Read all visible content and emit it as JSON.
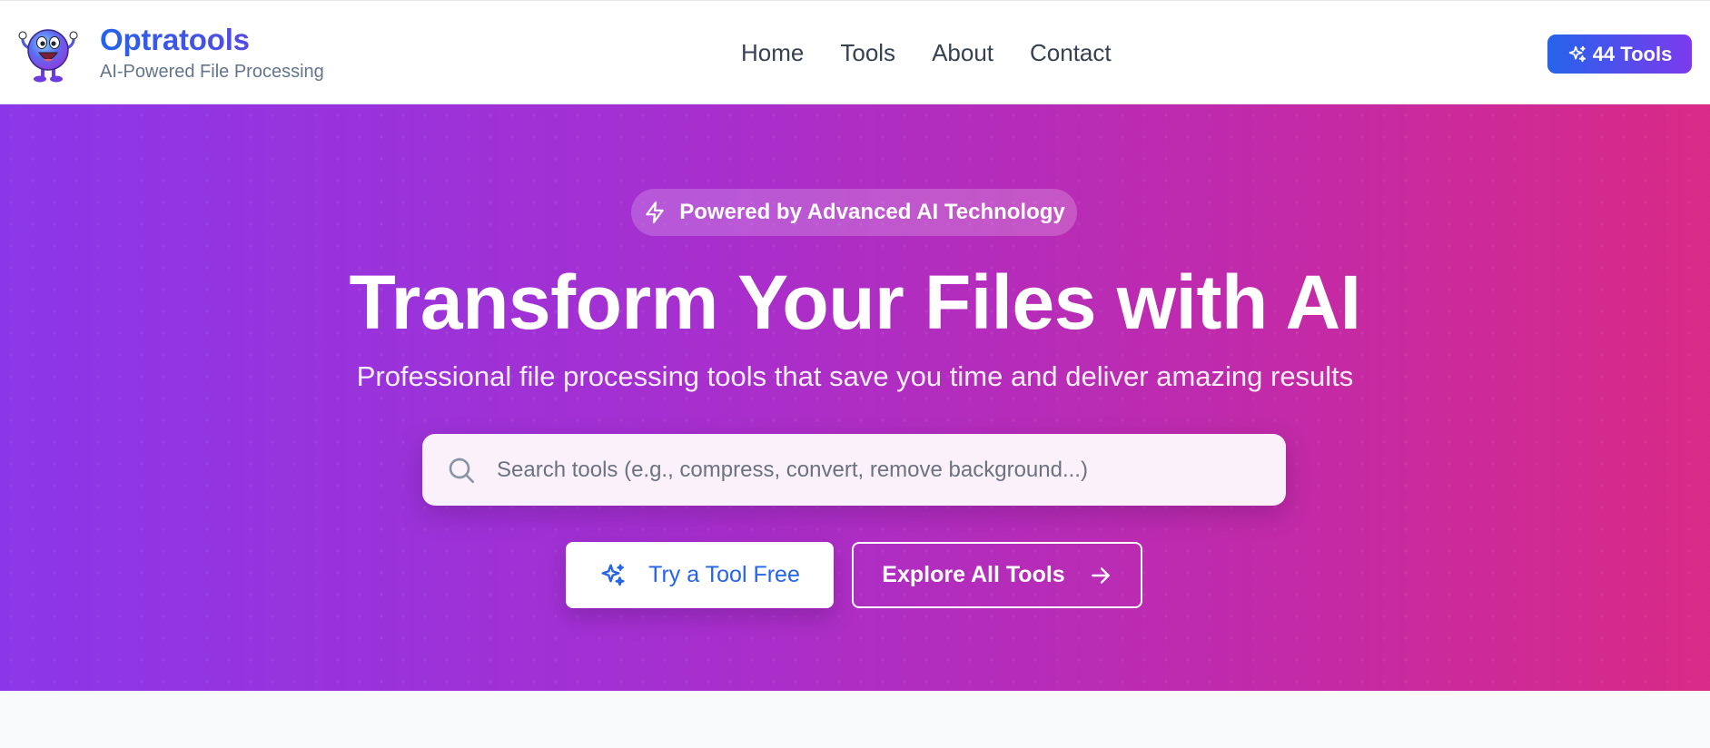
{
  "header": {
    "brand_name": "Optratools",
    "brand_tagline": "AI-Powered File Processing",
    "nav": [
      {
        "label": "Home"
      },
      {
        "label": "Tools"
      },
      {
        "label": "About"
      },
      {
        "label": "Contact"
      }
    ],
    "tools_badge": "44 Tools"
  },
  "hero": {
    "pill_label": "Powered by Advanced AI Technology",
    "title": "Transform Your Files with AI",
    "subtitle": "Professional file processing tools that save you time and deliver amazing results",
    "search": {
      "placeholder": "Search tools (e.g., compress, convert, remove background...)",
      "value": ""
    },
    "primary_button": "Try a Tool Free",
    "secondary_button": "Explore All Tools"
  },
  "colors": {
    "brand_blue": "#2563eb",
    "brand_purple": "#7c3aed",
    "hero_gradient_start": "#8b37e9",
    "hero_gradient_end": "#d92a86",
    "nav_text": "#374151",
    "tagline_text": "#64748b"
  },
  "icons": {
    "logo": "mascot-logo-icon",
    "badge": "sparkles-icon",
    "pill": "lightning-icon",
    "search": "search-icon",
    "primary_button": "sparkles-icon",
    "secondary_button": "arrow-right-icon"
  }
}
